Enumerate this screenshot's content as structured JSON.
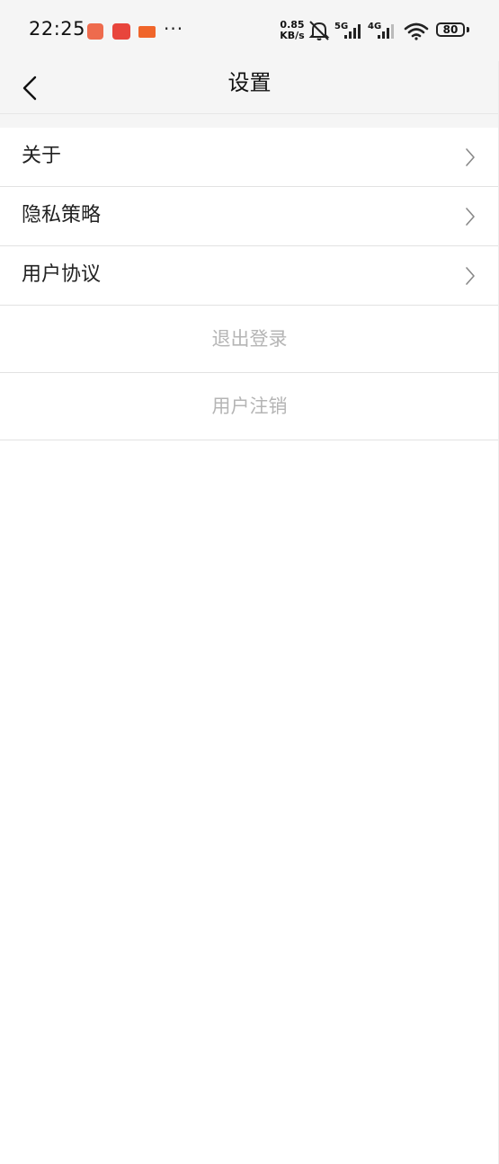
{
  "status_bar": {
    "time": "22:25",
    "more_dots": "···",
    "net_speed_value": "0.85",
    "net_speed_unit": "KB/s",
    "signal_5g_label": "5G",
    "signal_4g_label": "4G",
    "battery_level": "80",
    "icons": [
      "app-notification-icon",
      "app-notification-icon",
      "app-notification-icon",
      "mute-bell-icon",
      "signal-icon",
      "signal-icon",
      "wifi-icon",
      "battery-icon"
    ]
  },
  "header": {
    "title": "设置",
    "back_icon": "chevron-left-icon"
  },
  "menu": {
    "items": [
      {
        "label": "关于"
      },
      {
        "label": "隐私策略"
      },
      {
        "label": "用户协议"
      }
    ]
  },
  "actions": {
    "logout_label": "退出登录",
    "deregister_label": "用户注销"
  },
  "colors": {
    "background": "#ffffff",
    "header_background": "#f5f5f5",
    "primary_text": "#222222",
    "disabled_text": "#b5b5b5",
    "divider": "#e2e2e2"
  }
}
